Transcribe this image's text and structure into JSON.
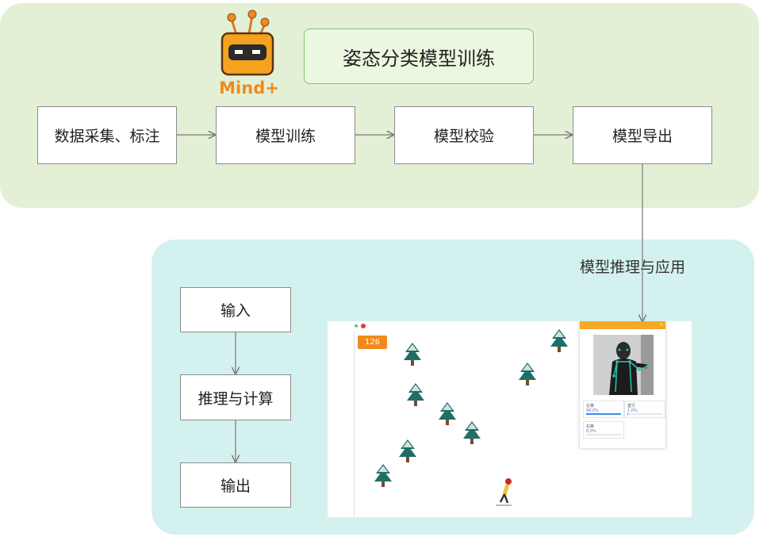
{
  "title": "姿态分类模型训练",
  "logo": {
    "text": "Mind+",
    "brand_color": "#f08a1c",
    "icon": "robot-head-icon"
  },
  "pipeline": [
    "数据采集、标注",
    "模型训练",
    "模型校验",
    "模型导出"
  ],
  "edge_label": "模型推理与应用",
  "inference_steps": [
    "输入",
    "推理与计算",
    "输出"
  ],
  "colors": {
    "top_panel": "#e3f0d6",
    "bottom_panel": "#d3f1ee",
    "title_border": "#7fc46b",
    "accent": "#f08a1c"
  },
  "screenshot": {
    "score": "126",
    "results": [
      {
        "label": "左移",
        "value": "99.0%",
        "fraction": 0.99
      },
      {
        "label": "直行",
        "value": "1.0%",
        "fraction": 0.01
      },
      {
        "label": "右移",
        "value": "0.0%",
        "fraction": 0.0
      }
    ]
  }
}
